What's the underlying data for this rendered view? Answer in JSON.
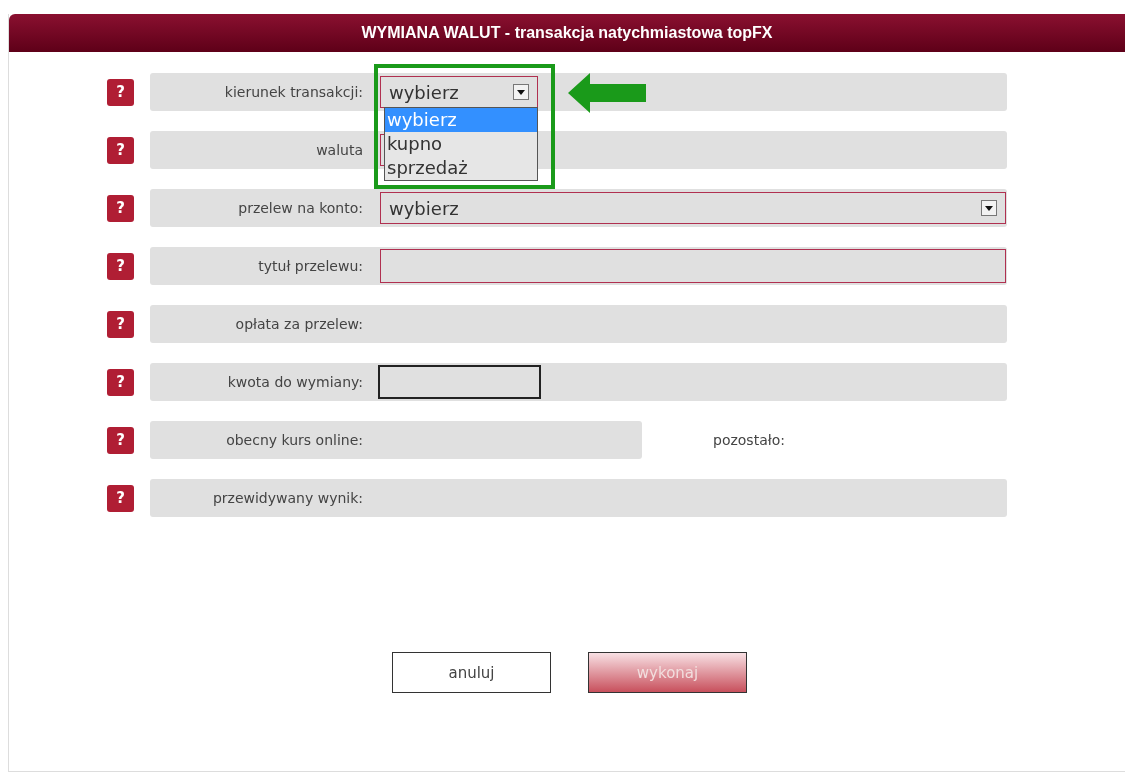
{
  "window": {
    "title": "WYMIANA WALUT - transakcja natychmiastowa topFX"
  },
  "rows": [
    {
      "help": "?",
      "label": "kierunek transakcji:",
      "kind": "short-select",
      "value": "wybierz",
      "expanded": true,
      "short_bar": false,
      "options": [
        {
          "label": "wybierz",
          "selected": true
        },
        {
          "label": "kupno",
          "selected": false
        },
        {
          "label": "sprzedaż",
          "selected": false
        }
      ]
    },
    {
      "help": "?",
      "label": "waluta",
      "kind": "short-select",
      "short_bar": false
    },
    {
      "help": "?",
      "label": "przelew na konto:",
      "kind": "select",
      "value": "wybierz",
      "short_bar": false
    },
    {
      "help": "?",
      "label": "tytuł przelewu:",
      "kind": "input",
      "short_bar": false
    },
    {
      "help": "?",
      "label": "opłata za przelew:",
      "kind": "none",
      "short_bar": false
    },
    {
      "help": "?",
      "label": "kwota do wymiany:",
      "kind": "short-input",
      "short_bar": false
    },
    {
      "help": "?",
      "label": "obecny kurs online:",
      "kind": "none",
      "short_bar": true,
      "side_label": "pozostało:"
    },
    {
      "help": "?",
      "label": "przewidywany wynik:",
      "kind": "none",
      "short_bar": false
    }
  ],
  "callout": {
    "kind": "box-and-arrow"
  },
  "buttons": [
    {
      "label": "anuluj",
      "disabled": false
    },
    {
      "label": "wykonaj",
      "disabled": true
    }
  ]
}
